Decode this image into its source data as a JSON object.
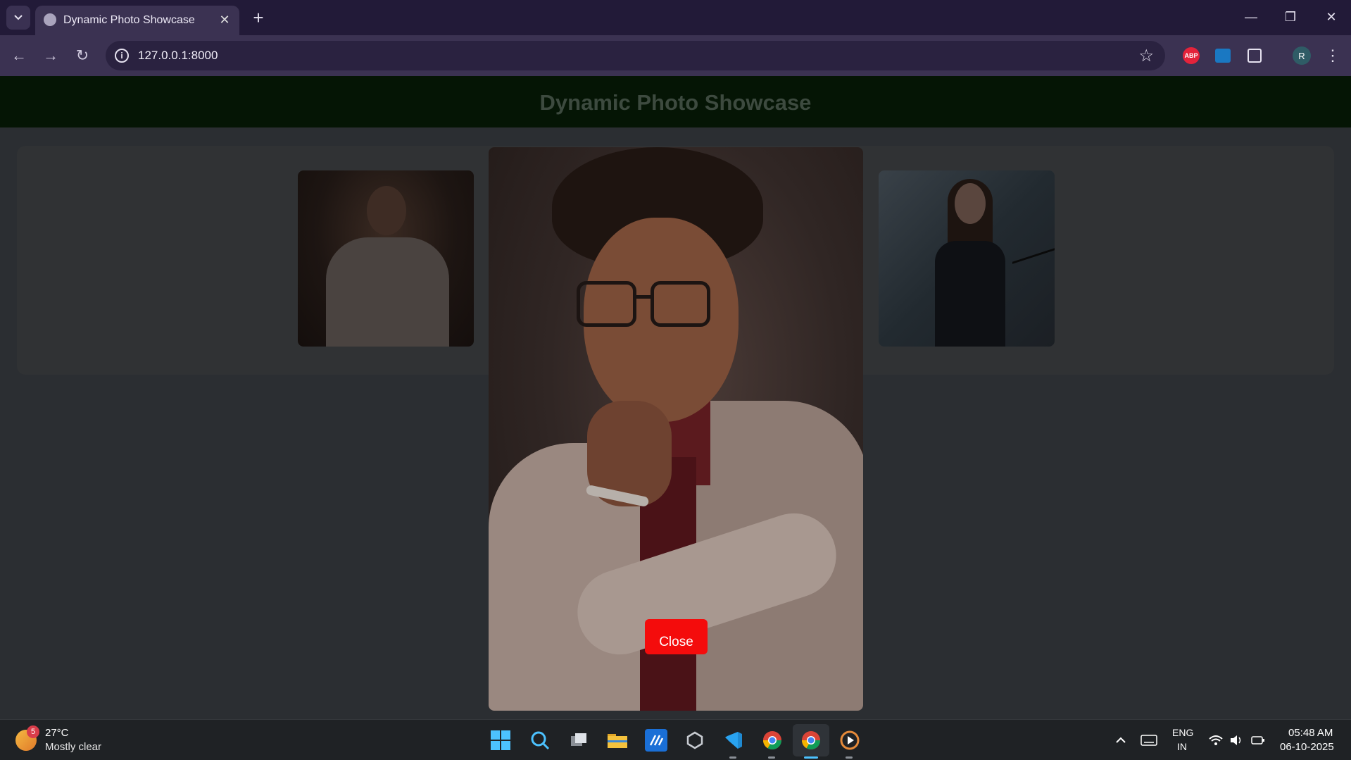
{
  "browser": {
    "tab_title": "Dynamic Photo Showcase",
    "url": "127.0.0.1:8000",
    "extensions": {
      "abp_label": "ABP",
      "profile_initial": "R"
    }
  },
  "page": {
    "header_title": "Dynamic Photo Showcase",
    "close_label": "Close"
  },
  "taskbar": {
    "weather": {
      "temp": "27°C",
      "desc": "Mostly clear",
      "badge": "5"
    },
    "language": {
      "line1": "ENG",
      "line2": "IN"
    },
    "clock": {
      "time": "05:48 AM",
      "date": "06-10-2025"
    }
  },
  "colors": {
    "header_bg": "#051505",
    "close_button": "#f40c0c",
    "page_bg": "#2b2e32"
  }
}
